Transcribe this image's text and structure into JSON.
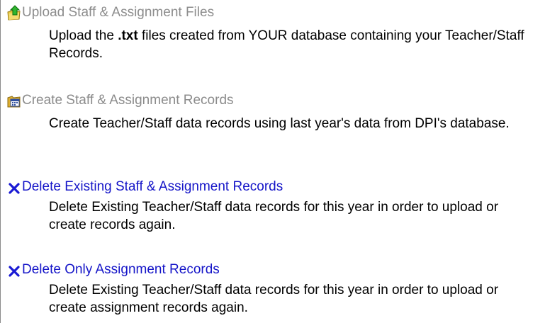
{
  "items": [
    {
      "icon": "upload-folder-icon",
      "title": "Upload Staff & Assignment Files",
      "desc_prefix": "Upload the ",
      "desc_bold": ".txt",
      "desc_suffix": " files created from YOUR database containing your Teacher/Staff Records."
    },
    {
      "icon": "records-folder-icon",
      "title": "Create Staff & Assignment Records",
      "desc": "Create Teacher/Staff data records using last year's data from DPI's database."
    },
    {
      "icon": "delete-x-icon",
      "title": "Delete Existing Staff & Assignment Records",
      "desc": "Delete Existing Teacher/Staff data records for this year in order to upload or create records again."
    },
    {
      "icon": "delete-x-icon",
      "title": "Delete Only Assignment Records",
      "desc": "Delete Existing Teacher/Staff data records for this year in order to upload or create assignment records again."
    }
  ],
  "colors": {
    "disabled_text": "#8c8c8c",
    "link_text": "#1515c8",
    "delete_icon": "#1a1ad4"
  }
}
